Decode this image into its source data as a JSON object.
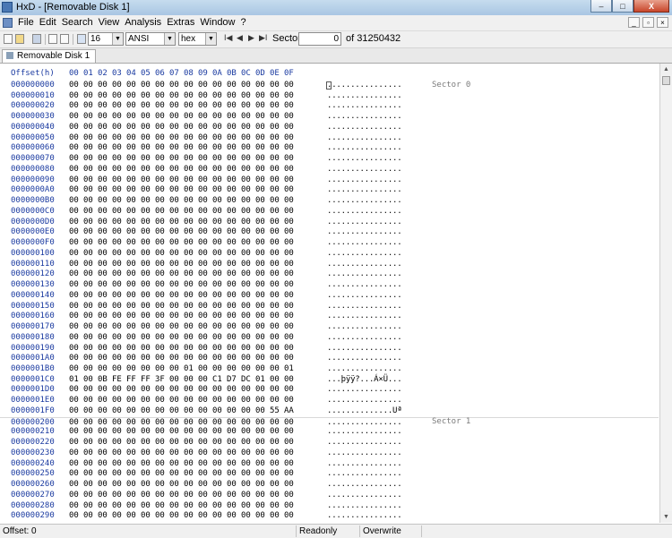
{
  "window": {
    "title": "HxD - [Removable Disk 1]",
    "controls": {
      "minimize": "–",
      "maximize": "□",
      "close": "X"
    }
  },
  "menubar": {
    "items": [
      "File",
      "Edit",
      "Search",
      "View",
      "Analysis",
      "Extras",
      "Window",
      "?"
    ],
    "mdi_controls": {
      "minimize": "_",
      "restore": "▫",
      "close": "×"
    }
  },
  "toolbar": {
    "bytes_per_row": "16",
    "charset": "ANSI",
    "offset_base": "hex",
    "nav": {
      "first": "I◀",
      "prev": "◀",
      "next": "▶",
      "last": "▶I"
    },
    "sector_label": "Sector",
    "sector_value": "0",
    "sector_total": "of 31250432"
  },
  "tab": {
    "label": "Removable Disk 1"
  },
  "hex_view": {
    "offset_header": "Offset(h)",
    "columns": [
      "00",
      "01",
      "02",
      "03",
      "04",
      "05",
      "06",
      "07",
      "08",
      "09",
      "0A",
      "0B",
      "0C",
      "0D",
      "0E",
      "0F"
    ],
    "sector_labels": [
      "Sector 0",
      "Sector 1"
    ],
    "rows": [
      {
        "offset": "000000000",
        "bytes": [
          "00",
          "00",
          "00",
          "00",
          "00",
          "00",
          "00",
          "00",
          "00",
          "00",
          "00",
          "00",
          "00",
          "00",
          "00",
          "00"
        ],
        "ascii": "................"
      },
      {
        "offset": "000000010",
        "bytes": [
          "00",
          "00",
          "00",
          "00",
          "00",
          "00",
          "00",
          "00",
          "00",
          "00",
          "00",
          "00",
          "00",
          "00",
          "00",
          "00"
        ],
        "ascii": "................"
      },
      {
        "offset": "000000020",
        "bytes": [
          "00",
          "00",
          "00",
          "00",
          "00",
          "00",
          "00",
          "00",
          "00",
          "00",
          "00",
          "00",
          "00",
          "00",
          "00",
          "00"
        ],
        "ascii": "................"
      },
      {
        "offset": "000000030",
        "bytes": [
          "00",
          "00",
          "00",
          "00",
          "00",
          "00",
          "00",
          "00",
          "00",
          "00",
          "00",
          "00",
          "00",
          "00",
          "00",
          "00"
        ],
        "ascii": "................"
      },
      {
        "offset": "000000040",
        "bytes": [
          "00",
          "00",
          "00",
          "00",
          "00",
          "00",
          "00",
          "00",
          "00",
          "00",
          "00",
          "00",
          "00",
          "00",
          "00",
          "00"
        ],
        "ascii": "................"
      },
      {
        "offset": "000000050",
        "bytes": [
          "00",
          "00",
          "00",
          "00",
          "00",
          "00",
          "00",
          "00",
          "00",
          "00",
          "00",
          "00",
          "00",
          "00",
          "00",
          "00"
        ],
        "ascii": "................"
      },
      {
        "offset": "000000060",
        "bytes": [
          "00",
          "00",
          "00",
          "00",
          "00",
          "00",
          "00",
          "00",
          "00",
          "00",
          "00",
          "00",
          "00",
          "00",
          "00",
          "00"
        ],
        "ascii": "................"
      },
      {
        "offset": "000000070",
        "bytes": [
          "00",
          "00",
          "00",
          "00",
          "00",
          "00",
          "00",
          "00",
          "00",
          "00",
          "00",
          "00",
          "00",
          "00",
          "00",
          "00"
        ],
        "ascii": "................"
      },
      {
        "offset": "000000080",
        "bytes": [
          "00",
          "00",
          "00",
          "00",
          "00",
          "00",
          "00",
          "00",
          "00",
          "00",
          "00",
          "00",
          "00",
          "00",
          "00",
          "00"
        ],
        "ascii": "................"
      },
      {
        "offset": "000000090",
        "bytes": [
          "00",
          "00",
          "00",
          "00",
          "00",
          "00",
          "00",
          "00",
          "00",
          "00",
          "00",
          "00",
          "00",
          "00",
          "00",
          "00"
        ],
        "ascii": "................"
      },
      {
        "offset": "0000000A0",
        "bytes": [
          "00",
          "00",
          "00",
          "00",
          "00",
          "00",
          "00",
          "00",
          "00",
          "00",
          "00",
          "00",
          "00",
          "00",
          "00",
          "00"
        ],
        "ascii": "................"
      },
      {
        "offset": "0000000B0",
        "bytes": [
          "00",
          "00",
          "00",
          "00",
          "00",
          "00",
          "00",
          "00",
          "00",
          "00",
          "00",
          "00",
          "00",
          "00",
          "00",
          "00"
        ],
        "ascii": "................"
      },
      {
        "offset": "0000000C0",
        "bytes": [
          "00",
          "00",
          "00",
          "00",
          "00",
          "00",
          "00",
          "00",
          "00",
          "00",
          "00",
          "00",
          "00",
          "00",
          "00",
          "00"
        ],
        "ascii": "................"
      },
      {
        "offset": "0000000D0",
        "bytes": [
          "00",
          "00",
          "00",
          "00",
          "00",
          "00",
          "00",
          "00",
          "00",
          "00",
          "00",
          "00",
          "00",
          "00",
          "00",
          "00"
        ],
        "ascii": "................"
      },
      {
        "offset": "0000000E0",
        "bytes": [
          "00",
          "00",
          "00",
          "00",
          "00",
          "00",
          "00",
          "00",
          "00",
          "00",
          "00",
          "00",
          "00",
          "00",
          "00",
          "00"
        ],
        "ascii": "................"
      },
      {
        "offset": "0000000F0",
        "bytes": [
          "00",
          "00",
          "00",
          "00",
          "00",
          "00",
          "00",
          "00",
          "00",
          "00",
          "00",
          "00",
          "00",
          "00",
          "00",
          "00"
        ],
        "ascii": "................"
      },
      {
        "offset": "000000100",
        "bytes": [
          "00",
          "00",
          "00",
          "00",
          "00",
          "00",
          "00",
          "00",
          "00",
          "00",
          "00",
          "00",
          "00",
          "00",
          "00",
          "00"
        ],
        "ascii": "................"
      },
      {
        "offset": "000000110",
        "bytes": [
          "00",
          "00",
          "00",
          "00",
          "00",
          "00",
          "00",
          "00",
          "00",
          "00",
          "00",
          "00",
          "00",
          "00",
          "00",
          "00"
        ],
        "ascii": "................"
      },
      {
        "offset": "000000120",
        "bytes": [
          "00",
          "00",
          "00",
          "00",
          "00",
          "00",
          "00",
          "00",
          "00",
          "00",
          "00",
          "00",
          "00",
          "00",
          "00",
          "00"
        ],
        "ascii": "................"
      },
      {
        "offset": "000000130",
        "bytes": [
          "00",
          "00",
          "00",
          "00",
          "00",
          "00",
          "00",
          "00",
          "00",
          "00",
          "00",
          "00",
          "00",
          "00",
          "00",
          "00"
        ],
        "ascii": "................"
      },
      {
        "offset": "000000140",
        "bytes": [
          "00",
          "00",
          "00",
          "00",
          "00",
          "00",
          "00",
          "00",
          "00",
          "00",
          "00",
          "00",
          "00",
          "00",
          "00",
          "00"
        ],
        "ascii": "................"
      },
      {
        "offset": "000000150",
        "bytes": [
          "00",
          "00",
          "00",
          "00",
          "00",
          "00",
          "00",
          "00",
          "00",
          "00",
          "00",
          "00",
          "00",
          "00",
          "00",
          "00"
        ],
        "ascii": "................"
      },
      {
        "offset": "000000160",
        "bytes": [
          "00",
          "00",
          "00",
          "00",
          "00",
          "00",
          "00",
          "00",
          "00",
          "00",
          "00",
          "00",
          "00",
          "00",
          "00",
          "00"
        ],
        "ascii": "................"
      },
      {
        "offset": "000000170",
        "bytes": [
          "00",
          "00",
          "00",
          "00",
          "00",
          "00",
          "00",
          "00",
          "00",
          "00",
          "00",
          "00",
          "00",
          "00",
          "00",
          "00"
        ],
        "ascii": "................"
      },
      {
        "offset": "000000180",
        "bytes": [
          "00",
          "00",
          "00",
          "00",
          "00",
          "00",
          "00",
          "00",
          "00",
          "00",
          "00",
          "00",
          "00",
          "00",
          "00",
          "00"
        ],
        "ascii": "................"
      },
      {
        "offset": "000000190",
        "bytes": [
          "00",
          "00",
          "00",
          "00",
          "00",
          "00",
          "00",
          "00",
          "00",
          "00",
          "00",
          "00",
          "00",
          "00",
          "00",
          "00"
        ],
        "ascii": "................"
      },
      {
        "offset": "0000001A0",
        "bytes": [
          "00",
          "00",
          "00",
          "00",
          "00",
          "00",
          "00",
          "00",
          "00",
          "00",
          "00",
          "00",
          "00",
          "00",
          "00",
          "00"
        ],
        "ascii": "................"
      },
      {
        "offset": "0000001B0",
        "bytes": [
          "00",
          "00",
          "00",
          "00",
          "00",
          "00",
          "00",
          "00",
          "01",
          "00",
          "00",
          "00",
          "00",
          "00",
          "00",
          "01"
        ],
        "ascii": "................"
      },
      {
        "offset": "0000001C0",
        "bytes": [
          "01",
          "00",
          "0B",
          "FE",
          "FF",
          "FF",
          "3F",
          "00",
          "00",
          "00",
          "C1",
          "D7",
          "DC",
          "01",
          "00",
          "00"
        ],
        "ascii": "...þÿÿ?...Á×Ü..."
      },
      {
        "offset": "0000001D0",
        "bytes": [
          "00",
          "00",
          "00",
          "00",
          "00",
          "00",
          "00",
          "00",
          "00",
          "00",
          "00",
          "00",
          "00",
          "00",
          "00",
          "00"
        ],
        "ascii": "................"
      },
      {
        "offset": "0000001E0",
        "bytes": [
          "00",
          "00",
          "00",
          "00",
          "00",
          "00",
          "00",
          "00",
          "00",
          "00",
          "00",
          "00",
          "00",
          "00",
          "00",
          "00"
        ],
        "ascii": "................"
      },
      {
        "offset": "0000001F0",
        "bytes": [
          "00",
          "00",
          "00",
          "00",
          "00",
          "00",
          "00",
          "00",
          "00",
          "00",
          "00",
          "00",
          "00",
          "00",
          "55",
          "AA"
        ],
        "ascii": "..............Uª"
      },
      {
        "offset": "000000200",
        "bytes": [
          "00",
          "00",
          "00",
          "00",
          "00",
          "00",
          "00",
          "00",
          "00",
          "00",
          "00",
          "00",
          "00",
          "00",
          "00",
          "00"
        ],
        "ascii": "................"
      },
      {
        "offset": "000000210",
        "bytes": [
          "00",
          "00",
          "00",
          "00",
          "00",
          "00",
          "00",
          "00",
          "00",
          "00",
          "00",
          "00",
          "00",
          "00",
          "00",
          "00"
        ],
        "ascii": "................"
      },
      {
        "offset": "000000220",
        "bytes": [
          "00",
          "00",
          "00",
          "00",
          "00",
          "00",
          "00",
          "00",
          "00",
          "00",
          "00",
          "00",
          "00",
          "00",
          "00",
          "00"
        ],
        "ascii": "................"
      },
      {
        "offset": "000000230",
        "bytes": [
          "00",
          "00",
          "00",
          "00",
          "00",
          "00",
          "00",
          "00",
          "00",
          "00",
          "00",
          "00",
          "00",
          "00",
          "00",
          "00"
        ],
        "ascii": "................"
      },
      {
        "offset": "000000240",
        "bytes": [
          "00",
          "00",
          "00",
          "00",
          "00",
          "00",
          "00",
          "00",
          "00",
          "00",
          "00",
          "00",
          "00",
          "00",
          "00",
          "00"
        ],
        "ascii": "................"
      },
      {
        "offset": "000000250",
        "bytes": [
          "00",
          "00",
          "00",
          "00",
          "00",
          "00",
          "00",
          "00",
          "00",
          "00",
          "00",
          "00",
          "00",
          "00",
          "00",
          "00"
        ],
        "ascii": "................"
      },
      {
        "offset": "000000260",
        "bytes": [
          "00",
          "00",
          "00",
          "00",
          "00",
          "00",
          "00",
          "00",
          "00",
          "00",
          "00",
          "00",
          "00",
          "00",
          "00",
          "00"
        ],
        "ascii": "................"
      },
      {
        "offset": "000000270",
        "bytes": [
          "00",
          "00",
          "00",
          "00",
          "00",
          "00",
          "00",
          "00",
          "00",
          "00",
          "00",
          "00",
          "00",
          "00",
          "00",
          "00"
        ],
        "ascii": "................"
      },
      {
        "offset": "000000280",
        "bytes": [
          "00",
          "00",
          "00",
          "00",
          "00",
          "00",
          "00",
          "00",
          "00",
          "00",
          "00",
          "00",
          "00",
          "00",
          "00",
          "00"
        ],
        "ascii": "................"
      },
      {
        "offset": "000000290",
        "bytes": [
          "00",
          "00",
          "00",
          "00",
          "00",
          "00",
          "00",
          "00",
          "00",
          "00",
          "00",
          "00",
          "00",
          "00",
          "00",
          "00"
        ],
        "ascii": "................"
      }
    ]
  },
  "scrollbar": {
    "up": "▲",
    "down": "▼"
  },
  "statusbar": {
    "offset": "Offset: 0",
    "mode": "Readonly",
    "insert_mode": "Overwrite"
  }
}
